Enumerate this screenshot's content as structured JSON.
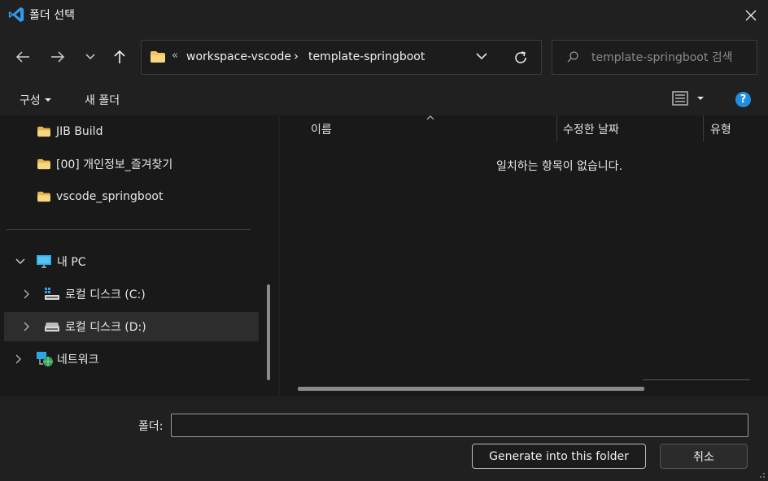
{
  "window": {
    "title": "폴더 선택"
  },
  "nav": {
    "breadcrumb_overflow": "«",
    "breadcrumbs": [
      "workspace-vscode",
      "template-springboot"
    ],
    "search_placeholder": "template-springboot 검색"
  },
  "toolbar": {
    "organize_label": "구성",
    "new_folder_label": "새 폴더",
    "help_label": "?"
  },
  "sidebar": {
    "items": [
      {
        "label": "JIB Build",
        "icon": "folder-icon"
      },
      {
        "label": "[00] 개인정보_즐겨찾기",
        "icon": "folder-icon"
      },
      {
        "label": "vscode_springboot",
        "icon": "folder-icon"
      },
      {
        "label": "내 PC",
        "icon": "computer-icon",
        "expanded": true
      },
      {
        "label": "로컬 디스크 (C:)",
        "icon": "system-drive-icon"
      },
      {
        "label": "로컬 디스크 (D:)",
        "icon": "drive-icon",
        "selected": true
      },
      {
        "label": "네트워크",
        "icon": "network-icon"
      }
    ]
  },
  "content": {
    "columns": [
      "이름",
      "수정한 날짜",
      "유형"
    ],
    "empty_message": "일치하는 항목이 없습니다."
  },
  "footer": {
    "folder_label": "폴더:",
    "folder_value": "",
    "primary_button": "Generate into this folder",
    "cancel_button": "취소"
  },
  "colors": {
    "accent": "#1f8ee0",
    "folder": "#f2c45a",
    "background": "#191919",
    "panel": "#202020"
  }
}
